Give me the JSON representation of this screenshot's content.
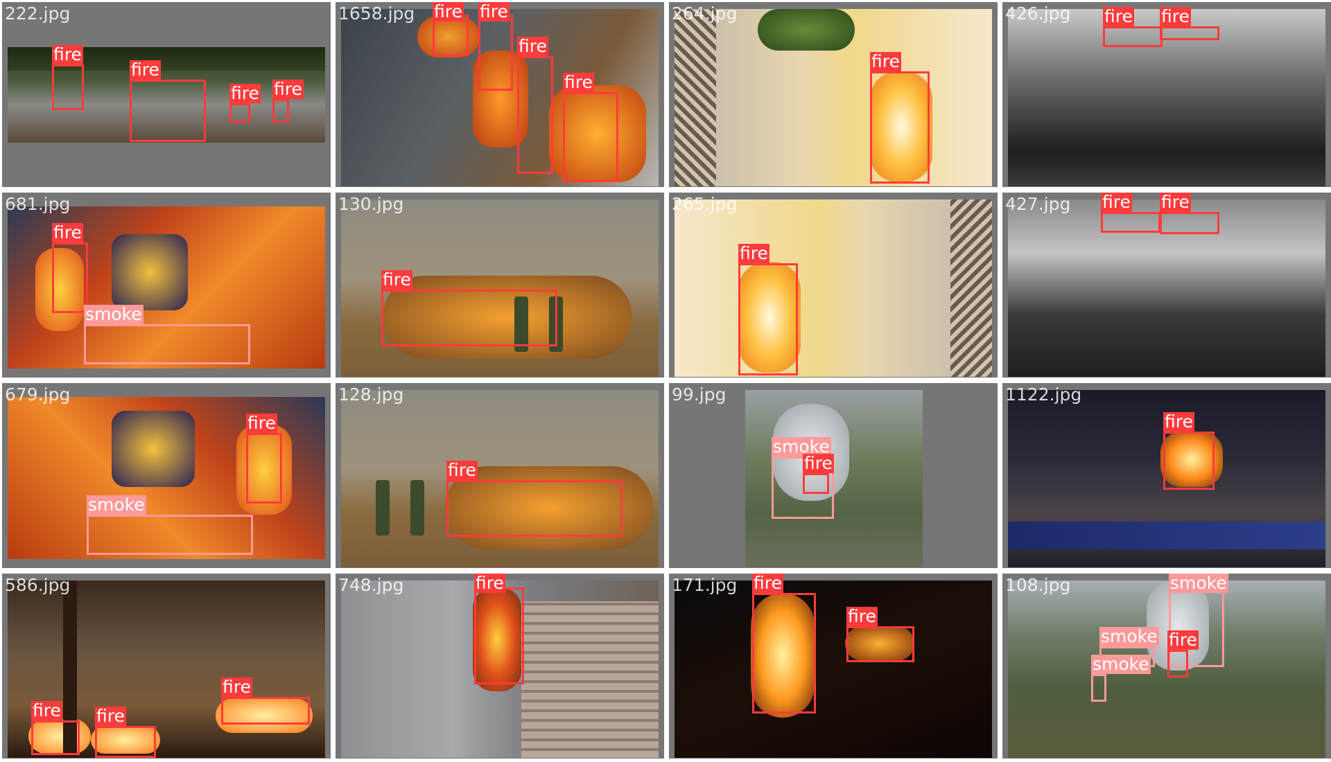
{
  "tiles": [
    {
      "filename": "222.jpg",
      "labels": [
        "fire",
        "fire",
        "fire",
        "fire"
      ]
    },
    {
      "filename": "1658.jpg",
      "labels": [
        "fire",
        "fire",
        "fire",
        "fire"
      ]
    },
    {
      "filename": "264.jpg",
      "labels": [
        "fire"
      ]
    },
    {
      "filename": "426.jpg",
      "labels": [
        "fire",
        "fire"
      ]
    },
    {
      "filename": "681.jpg",
      "labels": [
        "fire",
        "smoke"
      ]
    },
    {
      "filename": "130.jpg",
      "labels": [
        "fire"
      ]
    },
    {
      "filename": "265.jpg",
      "labels": [
        "fire"
      ]
    },
    {
      "filename": "427.jpg",
      "labels": [
        "fire",
        "fire"
      ]
    },
    {
      "filename": "679.jpg",
      "labels": [
        "fire",
        "smoke"
      ]
    },
    {
      "filename": "128.jpg",
      "labels": [
        "fire"
      ]
    },
    {
      "filename": "99.jpg",
      "labels": [
        "smoke",
        "fire"
      ]
    },
    {
      "filename": "1122.jpg",
      "labels": [
        "fire"
      ]
    },
    {
      "filename": "586.jpg",
      "labels": [
        "fire",
        "fire",
        "fire"
      ]
    },
    {
      "filename": "748.jpg",
      "labels": [
        "fire"
      ]
    },
    {
      "filename": "171.jpg",
      "labels": [
        "fire",
        "fire"
      ]
    },
    {
      "filename": "108.jpg",
      "labels": [
        "smoke",
        "fire",
        "smoke",
        "smoke"
      ]
    }
  ],
  "colors": {
    "fire": "#ff3b3b",
    "smoke": "#ff9a9a",
    "background": "#767676"
  }
}
